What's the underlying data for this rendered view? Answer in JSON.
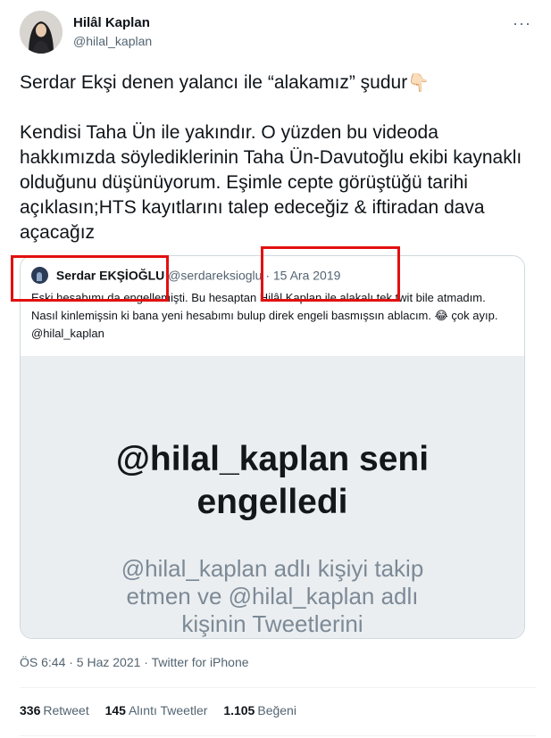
{
  "author": {
    "name": "Hilâl Kaplan",
    "handle": "@hilal_kaplan",
    "more_glyph": "···"
  },
  "tweet": {
    "line1": "Serdar Ekşi denen yalancı ile “alakamız” şudur",
    "line1_emoji": "👇🏻",
    "paragraph2": "Kendisi Taha Ün ile yakındır. O yüzden bu videoda hakkımızda söylediklerinin Taha Ün-Davutoğlu ekibi kaynaklı olduğunu düşünüyorum. Eşimle cepte görüştüğü tarihi açıklasın;HTS kayıtlarını talep edeceğiz & iftiradan dava açacağız"
  },
  "quoted": {
    "name": "Serdar EKŞİOĞLU",
    "handle": "@serdareksioglu",
    "separator": "·",
    "date": "15 Ara 2019",
    "text": "Eski hesabımı da engellemişti. Bu hesaptan Hilâl Kaplan ile alakalı tek twit bile atmadım. Nasıl kinlemişsin ki bana yeni hesabımı bulup direk engeli basmışsın ablacım. 😂 çok ayıp. @hilal_kaplan",
    "image": {
      "title_line1": "@hilal_kaplan seni",
      "title_line2": "engelledi",
      "sub_line1": "@hilal_kaplan adlı kişiyi takip",
      "sub_line2": "etmen ve @hilal_kaplan adlı",
      "sub_line3": "kişinin Tweetlerini"
    }
  },
  "timestamp": "ÖS 6:44 · 5 Haz 2021 · Twitter for iPhone",
  "stats": {
    "retweets_count": "336",
    "retweets_label": "Retweet",
    "quotes_count": "145",
    "quotes_label": "Alıntı Tweetler",
    "likes_count": "1.105",
    "likes_label": "Beğeni"
  },
  "colors": {
    "accent_red": "#e31010",
    "muted": "#536471",
    "border": "#cfd9de"
  }
}
